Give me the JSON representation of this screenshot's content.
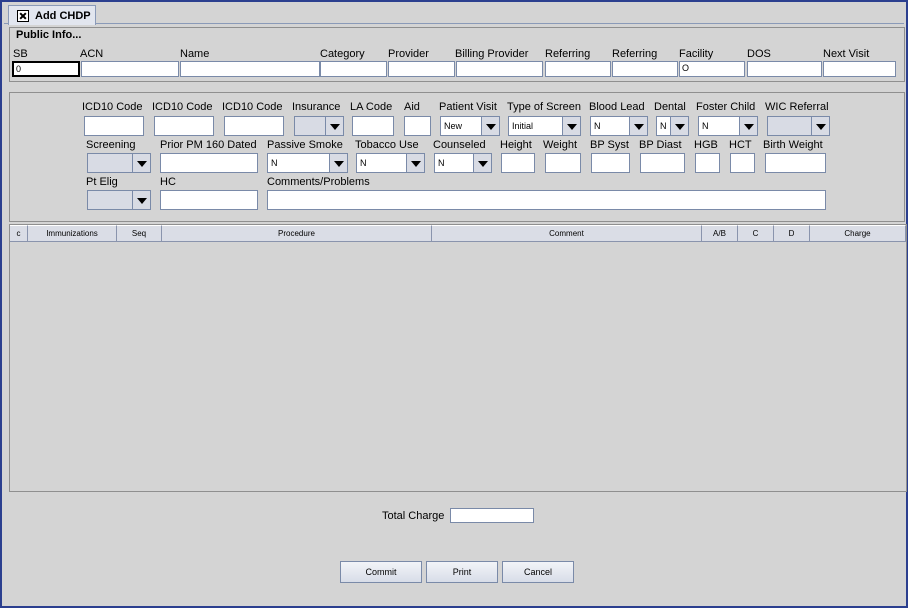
{
  "tab": {
    "title": "Add CHDP",
    "close_icon": "close-icon"
  },
  "public_info": {
    "legend": "Public Info...",
    "labels": {
      "sb": "SB",
      "acn": "ACN",
      "name": "Name",
      "category": "Category",
      "provider": "Provider",
      "billing_provider": "Billing Provider",
      "referring1": "Referring",
      "referring2": "Referring",
      "facility": "Facility",
      "dos": "DOS",
      "next_visit": "Next Visit"
    },
    "values": {
      "sb": "0",
      "facility": "O"
    }
  },
  "details": {
    "labels": {
      "icd1": "ICD10 Code",
      "icd2": "ICD10 Code",
      "icd3": "ICD10 Code",
      "insurance": "Insurance",
      "la_code": "LA Code",
      "aid": "Aid",
      "patient_visit": "Patient Visit",
      "type_of_screen": "Type of Screen",
      "blood_lead": "Blood Lead",
      "dental": "Dental",
      "foster_child": "Foster Child",
      "wic_referral": "WIC Referral",
      "screening": "Screening",
      "prior_pm": "Prior PM 160 Dated",
      "passive_smoke": "Passive Smoke",
      "tobacco_use": "Tobacco Use",
      "counseled": "Counseled",
      "height": "Height",
      "weight": "Weight",
      "bp_syst": "BP Syst",
      "bp_diast": "BP Diast",
      "hgb": "HGB",
      "hct": "HCT",
      "birth_weight": "Birth Weight",
      "pt_elig": "Pt Elig",
      "hc": "HC",
      "comments": "Comments/Problems"
    },
    "values": {
      "patient_visit": "New",
      "type_of_screen": "Initial",
      "blood_lead": "N",
      "dental": "N",
      "foster_child": "N",
      "passive_smoke": "N",
      "tobacco_use": "N",
      "counseled": "N"
    }
  },
  "table": {
    "columns": [
      "c",
      "Immunizations",
      "Seq",
      "Procedure",
      "Comment",
      "A/B",
      "C",
      "D",
      "Charge"
    ]
  },
  "footer": {
    "total_charge_label": "Total Charge",
    "buttons": {
      "commit": "Commit",
      "print": "Print",
      "cancel": "Cancel"
    }
  }
}
